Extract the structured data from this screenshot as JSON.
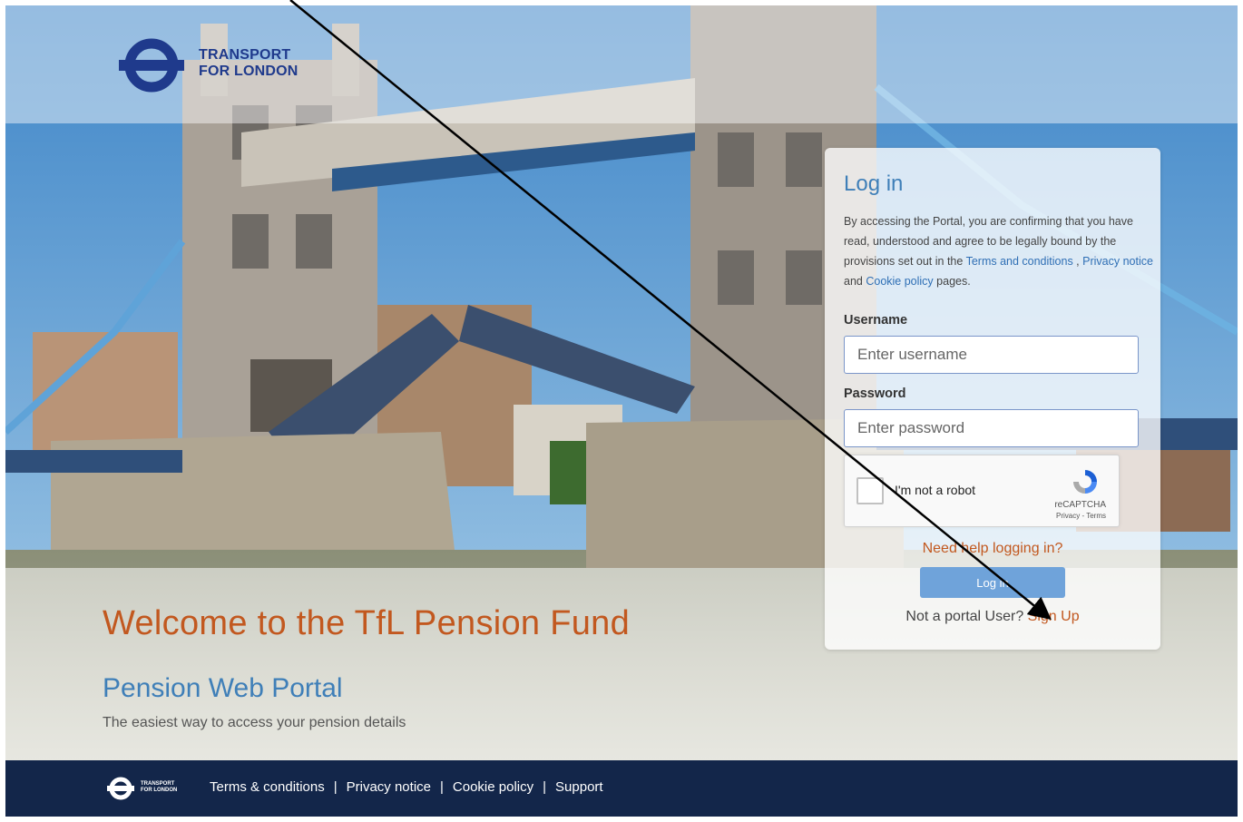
{
  "header": {
    "logo_line1": "TRANSPORT",
    "logo_line2": "FOR LONDON"
  },
  "hero": {
    "welcome": "Welcome to the TfL Pension Fund",
    "portal_title": "Pension Web Portal",
    "portal_subtitle": "The easiest way to access your pension details"
  },
  "login": {
    "heading": "Log in",
    "desc_intro": "By accessing the Portal, you are confirming that you have read, understood and agree to be legally bound by the provisions set out in the ",
    "terms_link": "Terms and conditions",
    "sep_comma": " , ",
    "privacy_link": "Privacy notice",
    "and_text": " and ",
    "cookie_link": "Cookie policy",
    "pages_text": " pages.",
    "username_label": "Username",
    "username_placeholder": "Enter username",
    "password_label": "Password",
    "password_placeholder": "Enter password",
    "captcha_label": "I'm not a robot",
    "captcha_brand": "reCAPTCHA",
    "captcha_links": "Privacy - Terms",
    "help_link": "Need help logging in?",
    "login_button": "Log in",
    "not_user_text": "Not a portal User? ",
    "signup_link": "Sign Up"
  },
  "footer": {
    "logo_line1": "TRANSPORT",
    "logo_line2": "FOR LONDON",
    "terms": "Terms & conditions",
    "privacy": "Privacy notice",
    "cookie": "Cookie policy",
    "support": "Support",
    "separator": "|"
  },
  "colors": {
    "accent_orange": "#c2581f",
    "accent_blue": "#3f7fb8",
    "footer_bg": "#13264a",
    "button_bg": "#6fa3da",
    "tfl_roundel": "#1f3a8c"
  },
  "icons": {
    "logo": "tfl-roundel-icon",
    "captcha": "recaptcha-icon",
    "annotation": "arrow-annotation"
  }
}
